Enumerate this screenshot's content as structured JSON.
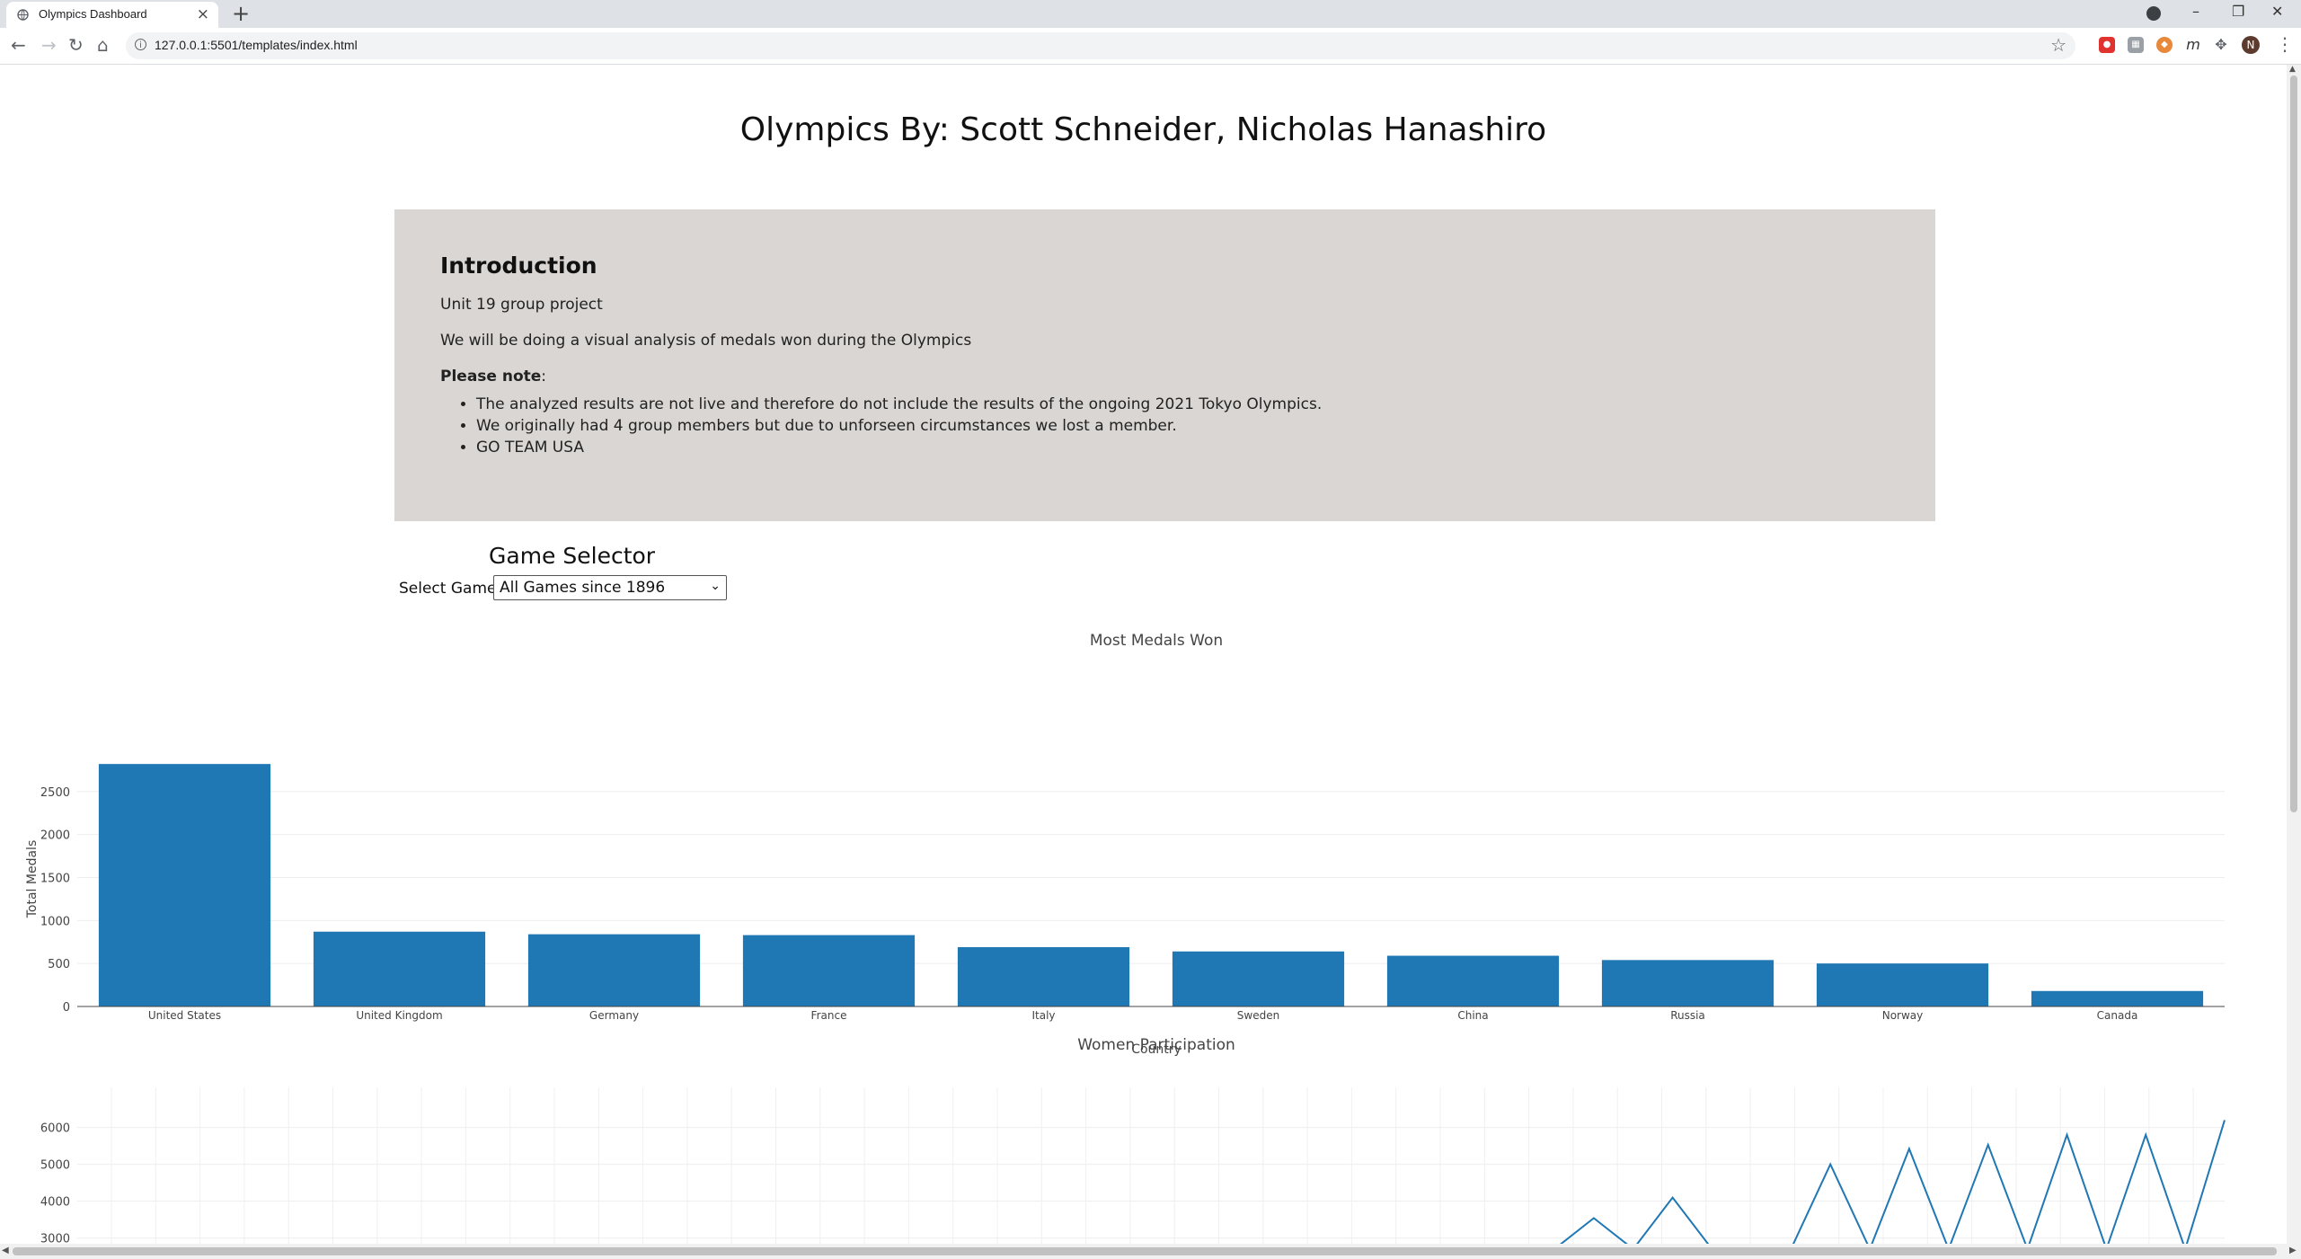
{
  "browser": {
    "tab_title": "Olympics Dashboard",
    "url": "127.0.0.1:5501/templates/index.html",
    "profile_initial": "N",
    "extensions": [
      "adblock-icon",
      "extension-grey-icon",
      "extension-orange-icon",
      "mendeley-icon",
      "puzzle-icon"
    ]
  },
  "page": {
    "title": "Olympics By: Scott Schneider, Nicholas Hanashiro",
    "intro": {
      "heading": "Introduction",
      "line1": "Unit 19 group project",
      "line2": "We will be doing a visual analysis of medals won during the Olympics",
      "note_bold": "Please note",
      "note_colon": ":",
      "bullets": [
        "The analyzed results are not live and therefore do not include the results of the ongoing 2021 Tokyo Olympics.",
        "We originally had 4 group members but due to unforseen circumstances we lost a member.",
        "GO TEAM USA"
      ]
    },
    "selector": {
      "title": "Game Selector",
      "label": "Select Game:",
      "selected": "All Games since 1896"
    }
  },
  "chart_data": [
    {
      "type": "bar",
      "title": "Most Medals Won",
      "xlabel": "Country",
      "ylabel": "Total Medals",
      "categories": [
        "United States",
        "United Kingdom",
        "Germany",
        "France",
        "Italy",
        "Sweden",
        "China",
        "Russia",
        "Norway",
        "Canada"
      ],
      "values": [
        2820,
        870,
        840,
        830,
        690,
        640,
        590,
        540,
        500,
        180
      ],
      "yticks": [
        0,
        500,
        1000,
        1500,
        2000,
        2500
      ],
      "ylim": [
        0,
        2968
      ],
      "color": "#1f77b4",
      "grid": true
    },
    {
      "type": "line",
      "title": "Women Participation",
      "yticks": [
        3000,
        4000,
        5000,
        6000
      ],
      "ylim": [
        2700,
        6600
      ],
      "color": "#1f77b4",
      "grid": true,
      "points": [
        {
          "x": 0,
          "y": 2700
        },
        {
          "x": 0.5,
          "y": 3540
        },
        {
          "x": 1,
          "y": 2700
        },
        {
          "x": 1.5,
          "y": 4100
        },
        {
          "x": 2,
          "y": 2700
        },
        {
          "x": 3,
          "y": 2700
        },
        {
          "x": 3.5,
          "y": 5000
        },
        {
          "x": 4,
          "y": 2700
        },
        {
          "x": 4.5,
          "y": 5420
        },
        {
          "x": 5,
          "y": 2700
        },
        {
          "x": 5.5,
          "y": 5530
        },
        {
          "x": 6,
          "y": 2700
        },
        {
          "x": 6.5,
          "y": 5800
        },
        {
          "x": 7,
          "y": 2700
        },
        {
          "x": 7.5,
          "y": 5800
        },
        {
          "x": 8,
          "y": 2700
        },
        {
          "x": 8.5,
          "y": 6200
        }
      ]
    }
  ]
}
